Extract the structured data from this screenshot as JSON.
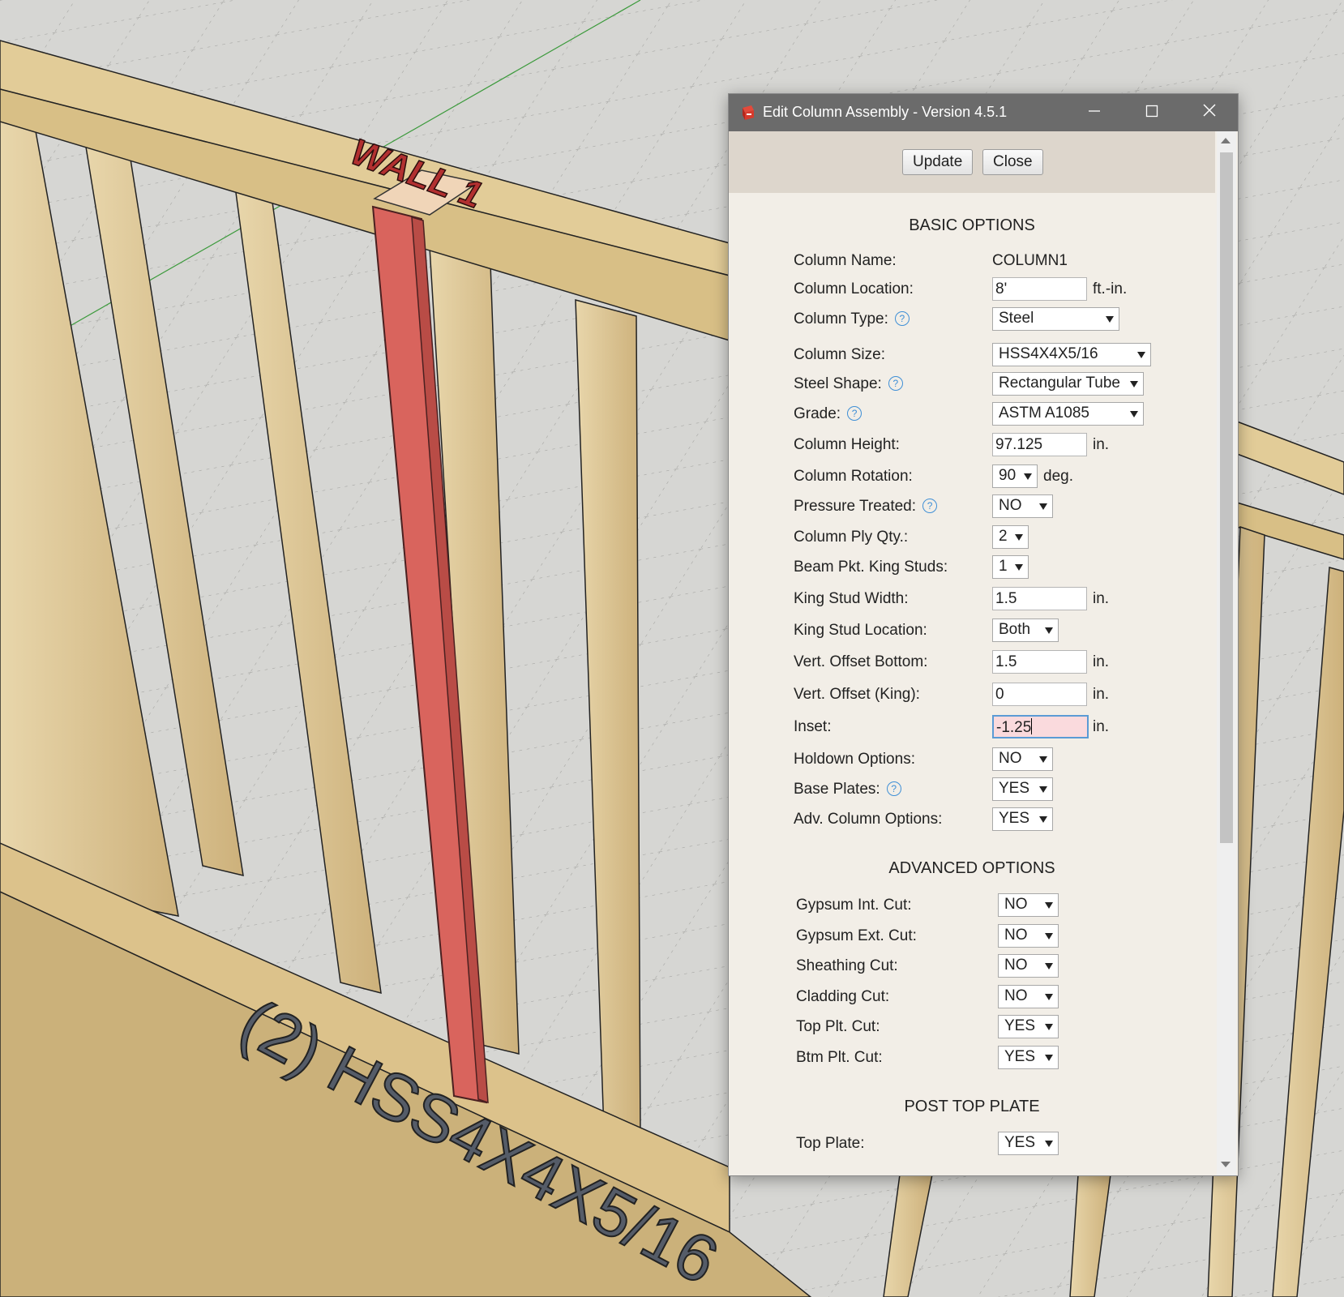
{
  "scene": {
    "wall_label": "WALL 1",
    "column_label": "(2) HSS4X4X5/16",
    "colors": {
      "floor": "#d6d6d3",
      "lumber": "#dcc595",
      "steel_column": "#d9645d"
    }
  },
  "dialog": {
    "title": "Edit Column Assembly - Version 4.5.1",
    "update_label": "Update",
    "close_label": "Close",
    "basic_title": "BASIC OPTIONS",
    "advanced_title": "ADVANCED OPTIONS",
    "post_top_title": "POST TOP PLATE",
    "fields": {
      "column_name": {
        "label": "Column Name:",
        "value": "COLUMN1"
      },
      "column_location": {
        "label": "Column Location:",
        "value": "8'",
        "unit": "ft.-in."
      },
      "column_type": {
        "label": "Column Type:",
        "value": "Steel"
      },
      "column_size": {
        "label": "Column Size:",
        "value": "HSS4X4X5/16"
      },
      "steel_shape": {
        "label": "Steel Shape:",
        "value": "Rectangular Tube"
      },
      "grade": {
        "label": "Grade:",
        "value": "ASTM A1085"
      },
      "column_height": {
        "label": "Column Height:",
        "value": "97.125",
        "unit": "in."
      },
      "column_rotation": {
        "label": "Column Rotation:",
        "value": "90",
        "unit": "deg."
      },
      "pressure_treated": {
        "label": "Pressure Treated:",
        "value": "NO"
      },
      "column_ply_qty": {
        "label": "Column Ply Qty.:",
        "value": "2"
      },
      "beam_pkt_king_studs": {
        "label": "Beam Pkt. King Studs:",
        "value": "1"
      },
      "king_stud_width": {
        "label": "King Stud Width:",
        "value": "1.5",
        "unit": "in."
      },
      "king_stud_location": {
        "label": "King Stud Location:",
        "value": "Both"
      },
      "vert_offset_bottom": {
        "label": "Vert. Offset Bottom:",
        "value": "1.5",
        "unit": "in."
      },
      "vert_offset_king": {
        "label": "Vert. Offset (King):",
        "value": "0",
        "unit": "in."
      },
      "inset": {
        "label": "Inset:",
        "value": "-1.25",
        "unit": "in."
      },
      "holdown_options": {
        "label": "Holdown Options:",
        "value": "NO"
      },
      "base_plates": {
        "label": "Base Plates:",
        "value": "YES"
      },
      "adv_column_options": {
        "label": "Adv. Column Options:",
        "value": "YES"
      },
      "gypsum_int_cut": {
        "label": "Gypsum Int. Cut:",
        "value": "NO"
      },
      "gypsum_ext_cut": {
        "label": "Gypsum Ext. Cut:",
        "value": "NO"
      },
      "sheathing_cut": {
        "label": "Sheathing Cut:",
        "value": "NO"
      },
      "cladding_cut": {
        "label": "Cladding Cut:",
        "value": "NO"
      },
      "top_plt_cut": {
        "label": "Top Plt. Cut:",
        "value": "YES"
      },
      "btm_plt_cut": {
        "label": "Btm Plt. Cut:",
        "value": "YES"
      },
      "top_plate": {
        "label": "Top Plate:",
        "value": "YES"
      }
    }
  }
}
